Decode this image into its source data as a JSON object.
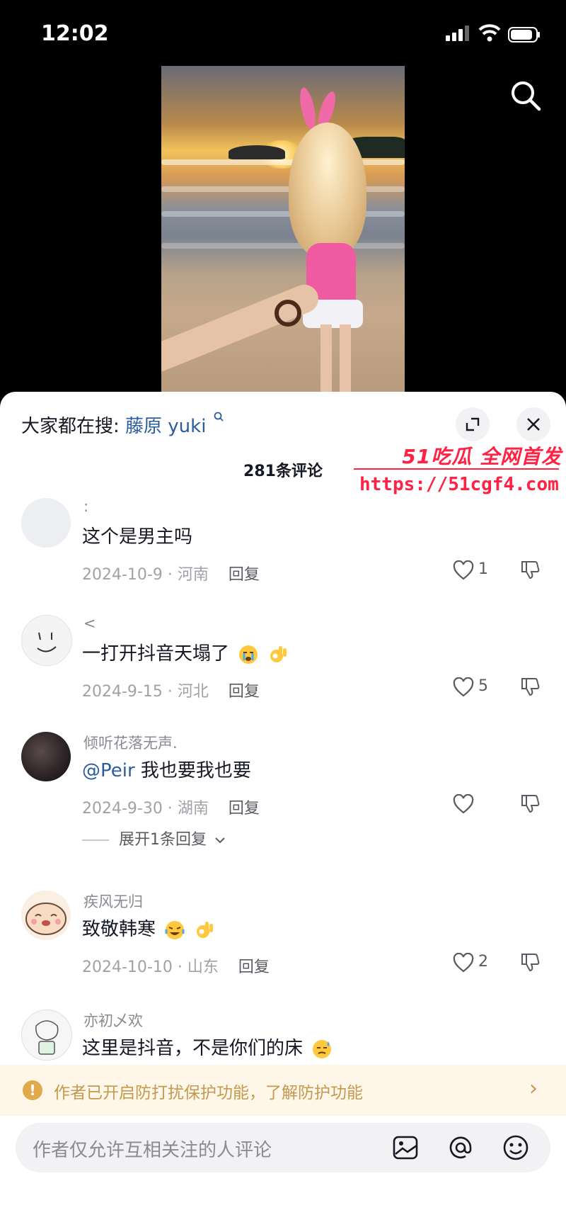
{
  "status_bar": {
    "time": "12:02"
  },
  "sheet": {
    "hot_search_prefix": "大家都在搜:",
    "hot_search_keyword": "藤原 yuki",
    "comment_count": "281条评论"
  },
  "watermark": {
    "line1": "51吃瓜 全网首发",
    "line2": "https://51cgf4.com"
  },
  "comments": [
    {
      "username": ":",
      "text": "这个是男主吗",
      "date_location": "2024-10-9 · 河南",
      "reply_label": "回复",
      "likes": "1"
    },
    {
      "username": "<",
      "text": "一打开抖音天塌了",
      "date_location": "2024-9-15 · 河北",
      "reply_label": "回复",
      "likes": "5"
    },
    {
      "username": "倾听花落无声.",
      "mention": "@Peir",
      "text": " 我也要我也要",
      "date_location": "2024-9-30 · 湖南",
      "reply_label": "回复",
      "likes": "",
      "expand_replies": "展开1条回复"
    },
    {
      "username": "疾风无归",
      "text": "致敬韩寒",
      "date_location": "2024-10-10 · 山东",
      "reply_label": "回复",
      "likes": "2"
    },
    {
      "username": "亦初乄欢",
      "text": "这里是抖音，不是你们的床"
    }
  ],
  "notice": {
    "text": "作者已开启防打扰保护功能，了解防护功能"
  },
  "input": {
    "placeholder": "作者仅允许互相关注的人评论"
  },
  "colors": {
    "link_blue": "#2b5c9e",
    "watermark_red": "#ff2244",
    "notice_bg": "#fdf6e9"
  }
}
